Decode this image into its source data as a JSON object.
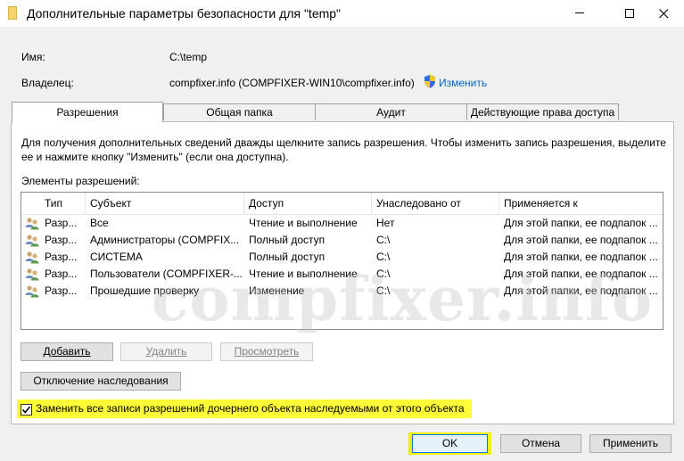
{
  "window": {
    "title": "Дополнительные параметры безопасности  для \"temp\"",
    "minimize_glyph": "—",
    "maximize_glyph": "☐",
    "close_glyph": "✕"
  },
  "info": {
    "name_label": "Имя:",
    "name_value": "C:\\temp",
    "owner_label": "Владелец:",
    "owner_value": "compfixer.info (COMPFIXER-WIN10\\compfixer.info)",
    "change_link": "Изменить"
  },
  "tabs": [
    {
      "label": "Разрешения",
      "active": true
    },
    {
      "label": "Общая папка",
      "active": false
    },
    {
      "label": "Аудит",
      "active": false
    },
    {
      "label": "Действующие права доступа",
      "active": false
    }
  ],
  "description": {
    "line1": "Для получения дополнительных сведений дважды щелкните запись разрешения. Чтобы изменить запись разрешения, выделите",
    "line2": "ее и нажмите кнопку \"Изменить\" (если она доступна)."
  },
  "permissions": {
    "label": "Элементы разрешений:",
    "columns": [
      "Тип",
      "Субъект",
      "Доступ",
      "Унаследовано от",
      "Применяется к"
    ],
    "rows": [
      {
        "type": "Разр...",
        "subject": "Все",
        "access": "Чтение и выполнение",
        "inherited": "Нет",
        "applies": "Для этой папки, ее подпапок ..."
      },
      {
        "type": "Разр...",
        "subject": "Администраторы (COMPFIX...",
        "access": "Полный доступ",
        "inherited": "C:\\",
        "applies": "Для этой папки, ее подпапок ..."
      },
      {
        "type": "Разр...",
        "subject": "СИСТЕМА",
        "access": "Полный доступ",
        "inherited": "C:\\",
        "applies": "Для этой папки, ее подпапок ..."
      },
      {
        "type": "Разр...",
        "subject": "Пользователи (COMPFIXER-...",
        "access": "Чтение и выполнение",
        "inherited": "C:\\",
        "applies": "Для этой папки, ее подпапок ..."
      },
      {
        "type": "Разр...",
        "subject": "Прошедшие проверку",
        "access": "Изменение",
        "inherited": "C:\\",
        "applies": "Для этой папки, ее подпапок ..."
      }
    ]
  },
  "buttons": {
    "add": "Добавить",
    "remove": "Удалить",
    "view": "Просмотреть",
    "disable_inheritance": "Отключение наследования",
    "ok": "OK",
    "cancel": "Отмена",
    "apply": "Применить"
  },
  "replace_checkbox": {
    "label": "Заменить все записи разрешений дочернего объекта наследуемыми от этого объекта",
    "checked": true,
    "check_glyph": "✔"
  },
  "watermark": "compfixer.info",
  "colors": {
    "highlight": "#fffd38",
    "link": "#0066cc"
  }
}
